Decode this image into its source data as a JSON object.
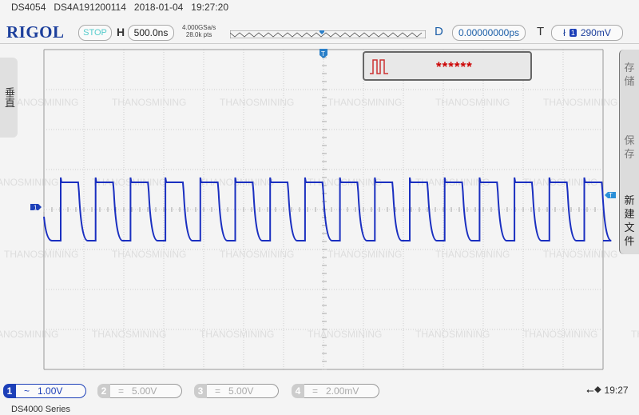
{
  "header": {
    "model": "DS4054",
    "serial": "DS4A191200114",
    "date": "2018-01-04",
    "time": "19:27:20"
  },
  "toolbar": {
    "logo": "RIGOL",
    "run_state": "STOP",
    "horizontal_label": "H",
    "timebase": "500.0ns",
    "sample_rate": "4.000GSa/s",
    "memory_depth": "28.0k pts",
    "delay_label": "D",
    "delay": "0.00000000ps",
    "trigger_label": "T",
    "trigger_edge_icon": "falling-edge-icon",
    "trigger_source": "1",
    "trigger_level": "290mV"
  },
  "left_menu": {
    "label": "垂直"
  },
  "right_menu": {
    "items": [
      {
        "label": "存储"
      },
      {
        "label": "保存"
      },
      {
        "label": "新建文件"
      }
    ]
  },
  "message": {
    "text": "******",
    "icon": "square-wave-icon"
  },
  "screen": {
    "watermark": "THANOSMINING",
    "ch1_marker": "1",
    "trigger_marker": "T",
    "trace_color": "#1a2fc0"
  },
  "channels": [
    {
      "num": "1",
      "coupling": "~",
      "scale": "1.00V",
      "active": true,
      "color": "#1c3fb8"
    },
    {
      "num": "2",
      "coupling": "=",
      "scale": "5.00V",
      "active": false
    },
    {
      "num": "3",
      "coupling": "=",
      "scale": "5.00V",
      "active": false
    },
    {
      "num": "4",
      "coupling": "=",
      "scale": "2.00mV",
      "active": false
    }
  ],
  "status": {
    "usb_icon": "usb-icon",
    "clock": "19:27"
  },
  "footer": {
    "series": "DS4000 Series"
  }
}
